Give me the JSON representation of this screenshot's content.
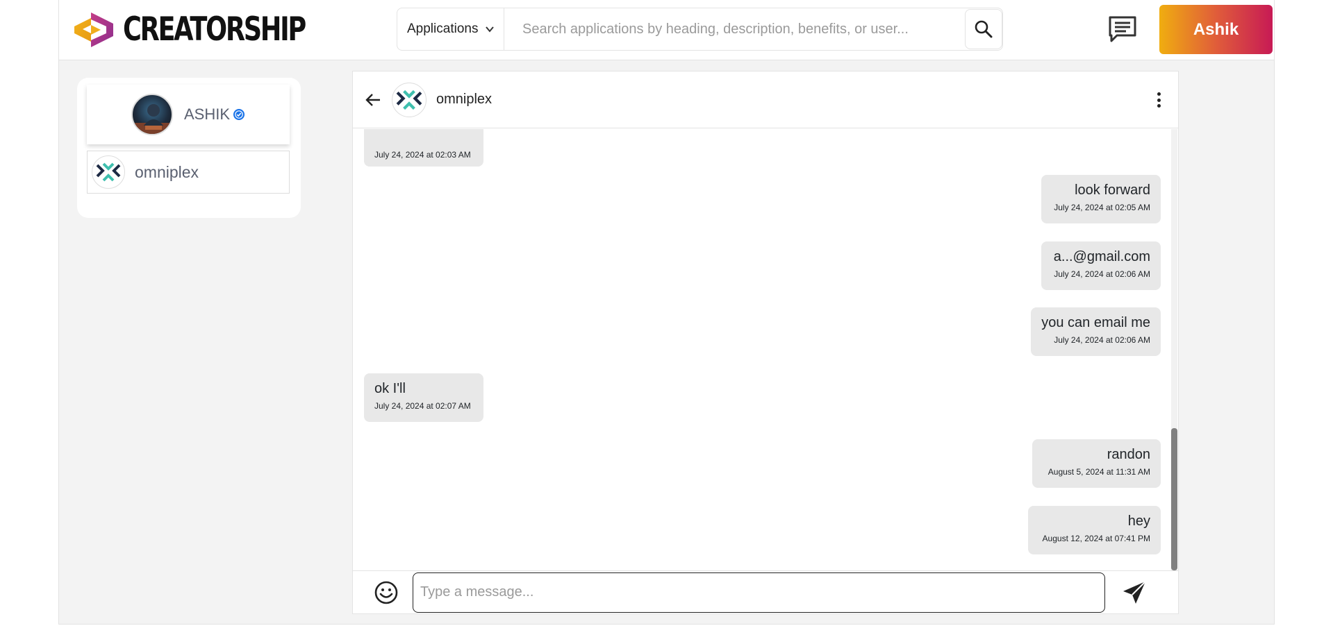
{
  "header": {
    "logo_text": "CREATORSHIP",
    "category_selected": "Applications",
    "search_placeholder": "Search applications by heading, description, benefits, or user...",
    "user_button_label": "Ashik",
    "icons": {
      "category": "chevron-down-icon",
      "search": "search-icon",
      "messages": "messages-icon"
    }
  },
  "sidebar": {
    "profile": {
      "name": "ASHIK",
      "verified": true
    },
    "contacts": [
      {
        "name": "omniplex"
      }
    ]
  },
  "chat": {
    "contact_name": "omniplex",
    "messages": [
      {
        "direction": "in",
        "text": "",
        "timestamp": "July 24, 2024 at 02:03 AM"
      },
      {
        "direction": "out",
        "text": "look forward",
        "timestamp": "July 24, 2024 at 02:05 AM"
      },
      {
        "direction": "out",
        "text": "a...@gmail.com",
        "timestamp": "July 24, 2024 at 02:06 AM"
      },
      {
        "direction": "out",
        "text": "you can email me",
        "timestamp": "July 24, 2024 at 02:06 AM"
      },
      {
        "direction": "in",
        "text": "ok I'll",
        "timestamp": "July 24, 2024 at 02:07 AM"
      },
      {
        "direction": "out",
        "text": "randon",
        "timestamp": "August 5, 2024 at 11:31 AM"
      },
      {
        "direction": "out",
        "text": "hey",
        "timestamp": "August 12, 2024 at 07:41 PM"
      }
    ],
    "composer_placeholder": "Type a message..."
  },
  "colors": {
    "accent_gradient": [
      "#f0ad10",
      "#c71a55"
    ],
    "bubble_bg": "#e8e8e8",
    "verified_badge": "#1a73e8"
  }
}
